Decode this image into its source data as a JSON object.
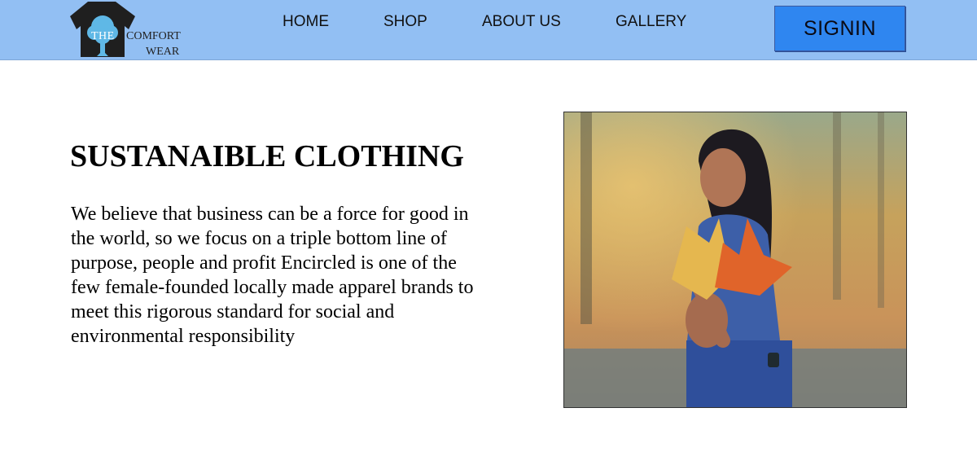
{
  "header": {
    "logo": {
      "line1_the": "THE",
      "line1_comfort": "COMFORT",
      "line2": "WEAR"
    },
    "nav": [
      {
        "label": "HOME"
      },
      {
        "label": "SHOP"
      },
      {
        "label": "ABOUT US"
      },
      {
        "label": "GALLERY"
      }
    ],
    "signin_label": "SIGNIN"
  },
  "main": {
    "heading": "SUSTANAIBLE CLOTHING",
    "body": "We believe that business can be a force for good in the world, so we focus on a triple bottom line of purpose, people and profit Encircled is one of the few female-founded locally made apparel brands to meet this rigorous standard for social and environmental responsibility"
  },
  "colors": {
    "nav_background": "#92bff3",
    "signin_button": "#2f86f0",
    "logo_tree": "#5fb8e6"
  }
}
